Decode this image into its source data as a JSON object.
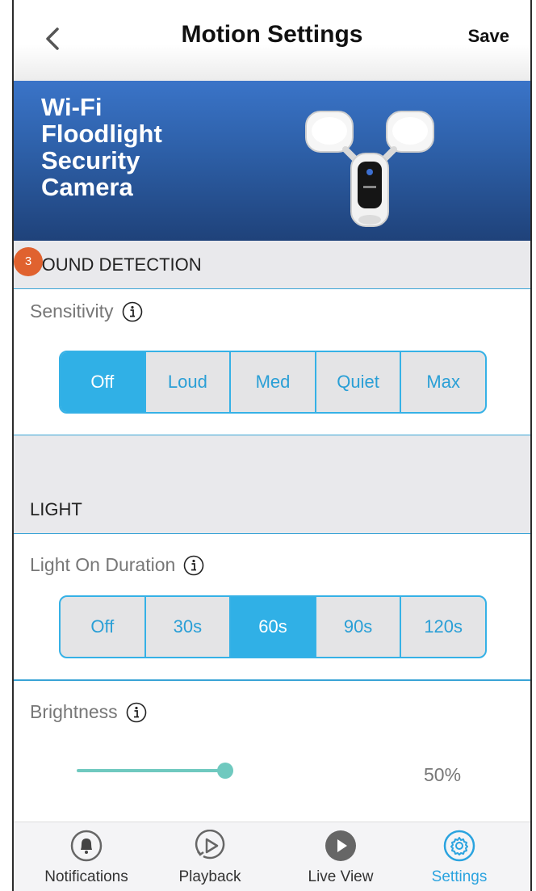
{
  "header": {
    "title": "Motion Settings",
    "save_label": "Save"
  },
  "banner": {
    "title": "Wi-Fi\nFloodlight\nSecurity\nCamera"
  },
  "badge": "3",
  "sound_detection": {
    "heading": "SOUND DETECTION",
    "sensitivity_label": "Sensitivity",
    "options": [
      "Off",
      "Loud",
      "Med",
      "Quiet",
      "Max"
    ],
    "selected": "Off"
  },
  "light": {
    "heading": "LIGHT",
    "duration_label": "Light On Duration",
    "options": [
      "Off",
      "30s",
      "60s",
      "90s",
      "120s"
    ],
    "selected": "60s",
    "brightness_label": "Brightness",
    "brightness_value": "50%",
    "brightness_fraction": 0.5
  },
  "tabbar": {
    "items": [
      {
        "label": "Notifications",
        "icon": "bell-icon"
      },
      {
        "label": "Playback",
        "icon": "playback-icon"
      },
      {
        "label": "Live View",
        "icon": "play-icon"
      },
      {
        "label": "Settings",
        "icon": "gear-icon"
      }
    ],
    "active": "Settings"
  },
  "colors": {
    "accent": "#30b0e6",
    "banner": "#2d5fa7",
    "slider": "#6fc9bf",
    "badge": "#e0622f"
  }
}
